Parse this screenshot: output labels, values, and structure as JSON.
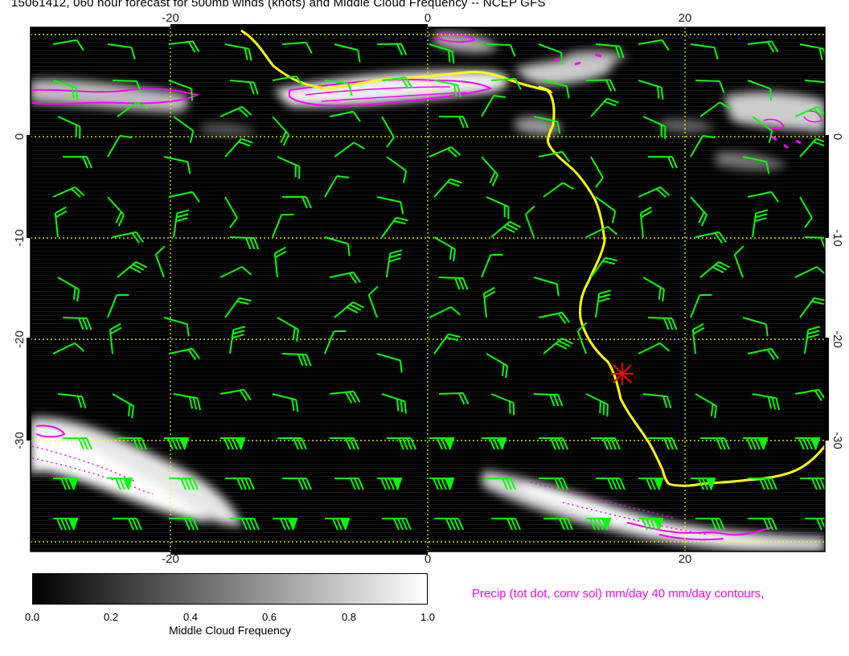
{
  "title": "15061412, 060 hour forecast for 500mb winds (knots) and Middle Cloud Frequency -- NCEP GFS",
  "lon_ticks": [
    "-20",
    "0",
    "20"
  ],
  "lat_ticks": [
    "0",
    "-10",
    "-20",
    "-30"
  ],
  "colorbar": {
    "title": "Middle Cloud Frequency",
    "ticks": [
      "0.0",
      "0.2",
      "0.4",
      "0.6",
      "0.8",
      "1.0"
    ]
  },
  "precip_label": "Precip (tot dot, conv sol) mm/day 40 mm/day contours,",
  "colors": {
    "background": "#000000",
    "wind_barbs": "#00ff00",
    "coastline": "#ffff00",
    "precip_contours": "#ff00ff",
    "gridlines": "#ffff00",
    "marker": "#ff0000"
  },
  "map": {
    "lon_range": [
      -31,
      30
    ],
    "lat_range": [
      -39,
      8
    ],
    "marker_lonlat": [
      15,
      -23.5
    ]
  }
}
